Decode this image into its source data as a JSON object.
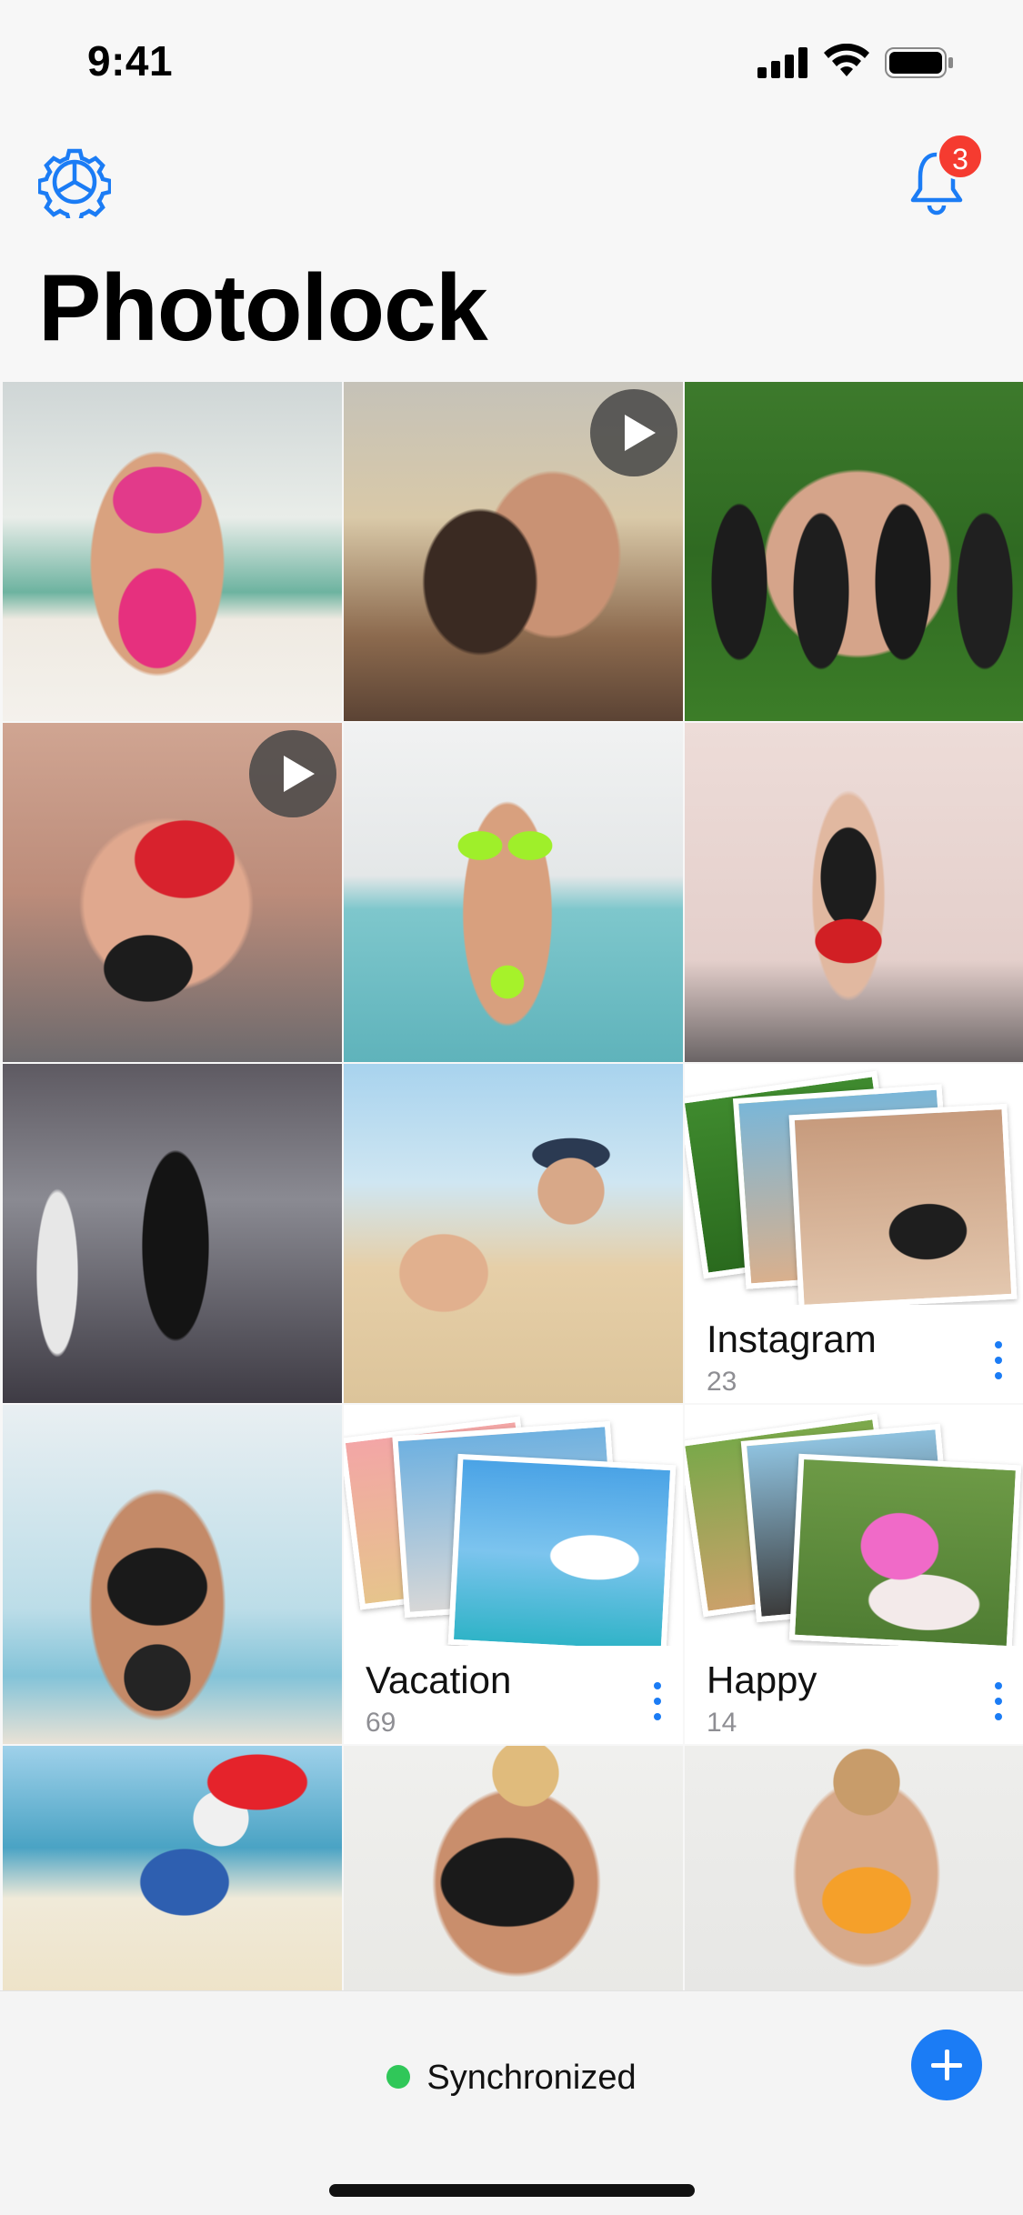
{
  "status_bar": {
    "time": "9:41"
  },
  "header": {
    "title": "Photolock",
    "notification_count": "3"
  },
  "tiles": [
    {
      "kind": "photo",
      "desc": "woman-pink-bikini",
      "video": false
    },
    {
      "kind": "photo",
      "desc": "couple-kissing-beach",
      "video": true
    },
    {
      "kind": "photo",
      "desc": "four-women-black-outfits",
      "video": false
    },
    {
      "kind": "photo",
      "desc": "party-group",
      "video": true
    },
    {
      "kind": "photo",
      "desc": "woman-neon-bikini-pool",
      "video": false
    },
    {
      "kind": "photo",
      "desc": "woman-devil-costume",
      "video": false
    },
    {
      "kind": "photo",
      "desc": "woman-black-bodysuit-garage",
      "video": false
    },
    {
      "kind": "photo",
      "desc": "couple-sand-beach",
      "video": false
    },
    {
      "kind": "album",
      "name": "Instagram",
      "count": "23"
    },
    {
      "kind": "photo",
      "desc": "woman-black-swimsuit-beach",
      "video": false
    },
    {
      "kind": "album",
      "name": "Vacation",
      "count": "69"
    },
    {
      "kind": "album",
      "name": "Happy",
      "count": "14"
    },
    {
      "kind": "photo",
      "desc": "dog-beach-chair",
      "video": false
    },
    {
      "kind": "photo",
      "desc": "woman-black-top",
      "video": false
    },
    {
      "kind": "photo",
      "desc": "woman-orange-swimsuit",
      "video": false
    }
  ],
  "albums": {
    "instagram": {
      "name": "Instagram",
      "count": "23"
    },
    "vacation": {
      "name": "Vacation",
      "count": "69"
    },
    "happy": {
      "name": "Happy",
      "count": "14"
    }
  },
  "bottom_bar": {
    "status": "Synchronized",
    "status_color": "#30c759"
  },
  "colors": {
    "accent": "#1b7cf5",
    "badge": "#f53b30",
    "background": "#f7f7f7"
  },
  "icons": [
    "gear-icon",
    "bell-icon",
    "play-icon",
    "more-vertical-icon",
    "plus-icon",
    "signal-icon",
    "wifi-icon",
    "battery-icon"
  ]
}
